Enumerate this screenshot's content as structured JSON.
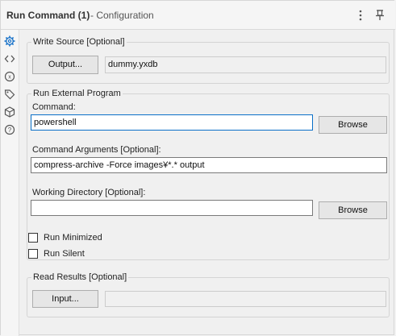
{
  "titlebar": {
    "title": "Run Command (1)",
    "subtitle": "- Configuration",
    "icons": [
      "more-vert-icon",
      "pin-icon"
    ]
  },
  "sidebar": {
    "icons": [
      "gear-icon",
      "code-icon",
      "variable-icon",
      "tag-icon",
      "cube-icon",
      "help-icon"
    ]
  },
  "write_source": {
    "legend": "Write Source [Optional]",
    "output_button": "Output...",
    "output_value": "dummy.yxdb"
  },
  "run_external": {
    "legend": "Run External Program",
    "command_label": "Command:",
    "command_value": "powershell",
    "browse_label": "Browse",
    "args_label": "Command Arguments [Optional]:",
    "args_value": "compress-archive -Force images¥*.* output",
    "workdir_label": "Working Directory [Optional]:",
    "workdir_value": "",
    "workdir_browse_label": "Browse"
  },
  "options": {
    "run_minimized_label": "Run Minimized",
    "run_minimized_checked": false,
    "run_silent_label": "Run Silent",
    "run_silent_checked": false
  },
  "read_results": {
    "legend": "Read Results [Optional]",
    "input_button": "Input...",
    "input_value": ""
  },
  "colors": {
    "accent": "#0a70c8",
    "panel_bg": "#f0f0f0"
  }
}
